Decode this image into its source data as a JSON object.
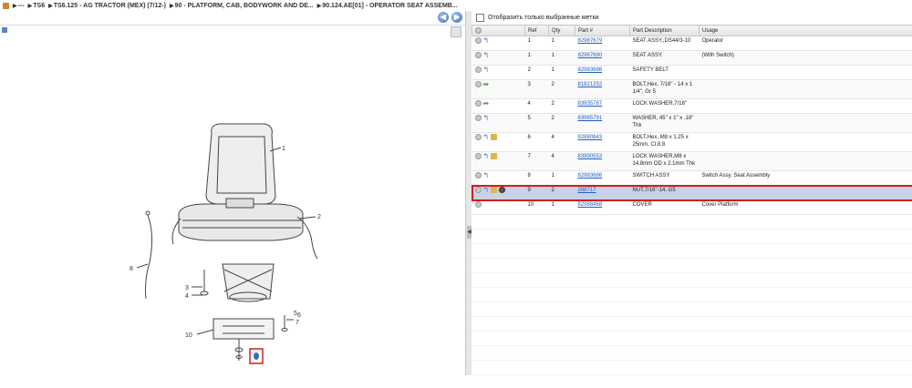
{
  "breadcrumb": {
    "items": [
      "---",
      "TS6",
      "TS6.125 - AG TRACTOR (MEX) (7/12-)",
      "90 - PLATFORM, CAB, BODYWORK AND DE...",
      "90.124.AE[01] - OPERATOR SEAT ASSEMB..."
    ]
  },
  "nav": {
    "back_icon": "back-arrow-icon",
    "forward_icon": "forward-arrow-icon",
    "back_glyph": "◀",
    "forward_glyph": "▶"
  },
  "filter": {
    "label": "Отобразить только выбранные метки",
    "checked": false
  },
  "table": {
    "headers": [
      "Ref",
      "Qty",
      "Part #",
      "Part Description",
      "Usage"
    ],
    "rows": [
      {
        "ref": "1",
        "qty": "1",
        "part": "82987679",
        "desc": "SEAT ASSY.,DS44/3-10",
        "usage": "Operator",
        "icons": [
          "info",
          "back"
        ]
      },
      {
        "ref": "1",
        "qty": "1",
        "part": "82987680",
        "desc": "SEAT ASSY.",
        "usage": "(With Switch)",
        "icons": [
          "info",
          "back"
        ]
      },
      {
        "ref": "2",
        "qty": "1",
        "part": "82983686",
        "desc": "SAFETY BELT",
        "usage": "",
        "icons": [
          "info",
          "back"
        ]
      },
      {
        "ref": "3",
        "qty": "2",
        "part": "81821252",
        "desc": "BOLT,Hex, 7/16\" - 14 x 1 1/4\", Gr 5",
        "usage": "",
        "icons": [
          "info",
          "fwd"
        ]
      },
      {
        "ref": "4",
        "qty": "2",
        "part": "83935787",
        "desc": "LOCK WASHER,7/16\"",
        "usage": "",
        "icons": [
          "info",
          "fwd"
        ]
      },
      {
        "ref": "5",
        "qty": "2",
        "part": "83985791",
        "desc": "WASHER, 45\" x 1\" x .18\" Thk",
        "usage": "",
        "icons": [
          "info",
          "back"
        ]
      },
      {
        "ref": "6",
        "qty": "4",
        "part": "82880843",
        "desc": "BOLT,Hex, M8 x 1.25 x 25mm, Cl.8.8",
        "usage": "",
        "icons": [
          "info",
          "back",
          "box"
        ]
      },
      {
        "ref": "7",
        "qty": "4",
        "part": "83990553",
        "desc": "LOCK WASHER,M8 x 14.8mm OD x 2.1mm Thk",
        "usage": "",
        "icons": [
          "info",
          "back",
          "box"
        ]
      },
      {
        "ref": "8",
        "qty": "1",
        "part": "82983686",
        "desc": "SWITCH ASSY",
        "usage": "Switch Assy. Seat Assembly",
        "icons": [
          "info",
          "back"
        ]
      },
      {
        "ref": "9",
        "qty": "2",
        "part": "288717",
        "desc": "NUT,7/16\"-14, G5",
        "usage": "",
        "icons": [
          "info",
          "back",
          "box",
          "gear"
        ],
        "selected": true
      },
      {
        "ref": "10",
        "qty": "1",
        "part": "82988468",
        "desc": "COVER",
        "usage": "Cover Platform",
        "icons": [
          "info"
        ]
      }
    ]
  },
  "diagram": {
    "callouts": [
      "1",
      "2",
      "3",
      "4",
      "5",
      "6",
      "7",
      "8",
      "10"
    ]
  },
  "colors": {
    "selection": "#c9d2e6",
    "highlight_border": "#d11d1d",
    "link": "#1f5fbf"
  }
}
